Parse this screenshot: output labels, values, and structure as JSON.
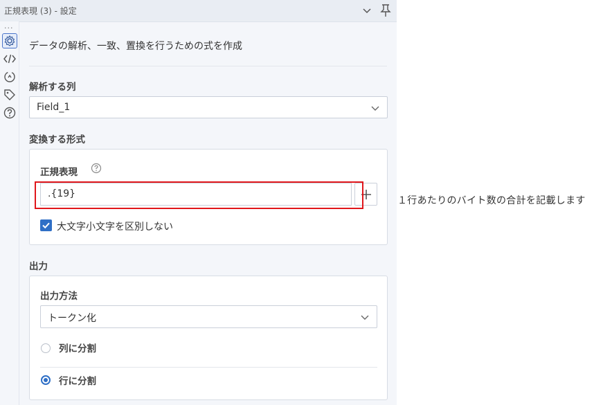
{
  "window": {
    "title": "正規表現 (3) - 設定"
  },
  "rail": {
    "dots": "...",
    "icons": [
      "gear-icon",
      "code-icon",
      "arrow-cycle-icon",
      "tag-icon",
      "help-icon"
    ]
  },
  "description": "データの解析、一致、置換を行うための式を作成",
  "parse_column": {
    "label": "解析する列",
    "selected": "Field_1"
  },
  "convert_format": {
    "label": "変換する形式",
    "regex_label": "正規表現",
    "regex_value": ".{19}",
    "case_insensitive_label": "大文字小文字を区別しない",
    "case_insensitive_checked": true
  },
  "output": {
    "label": "出力",
    "method_label": "出力方法",
    "method_selected": "トークン化",
    "options": [
      {
        "label": "列に分割",
        "checked": false
      },
      {
        "label": "行に分割",
        "checked": true
      }
    ]
  },
  "annotation": "１行あたりのバイト数の合計を記載します",
  "colors": {
    "accent": "#2f6fc6",
    "highlight": "#e0161b"
  }
}
